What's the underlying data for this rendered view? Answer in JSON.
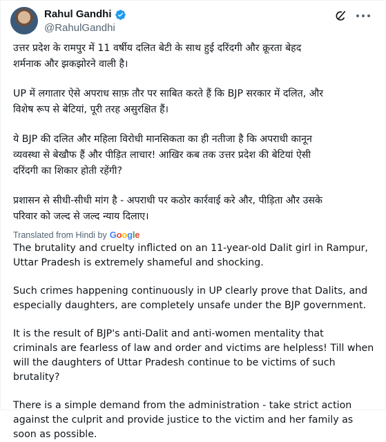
{
  "author": {
    "name": "Rahul Gandhi",
    "handle": "@RahulGandhi",
    "verified": true,
    "verified_color": "#1d9bf0"
  },
  "actions": {
    "grok_icon": "grok-icon",
    "more_icon": "more-icon"
  },
  "post": {
    "hindi_paragraphs": [
      "उत्तर प्रदेश के रामपुर में 11 वर्षीय दलित बेटी के साथ हुई दरिंदगी और क्रूरता बेहद\nशर्मनाक और झकझोरने वाली है।",
      "UP में लगातार ऐसे अपराध साफ़ तौर पर साबित करते हैं कि BJP सरकार में दलित, और\nविशेष रूप से बेटियां, पूरी तरह असुरक्षित हैं।",
      "ये BJP की दलित और महिला विरोधी मानसिकता का ही नतीजा है कि अपराधी कानून\nव्यवस्था से बेखौफ हैं और पीड़ित लाचार! आखिर कब तक उत्तर प्रदेश की बेटियां ऐसी\nदरिंदगी का शिकार होती रहेंगी?",
      "प्रशासन से सीधी-सीधी मांग है - अपराधी पर कठोर कार्रवाई करे और, पीड़िता और उसके\nपरिवार को जल्द से जल्द न्याय दिलाए।"
    ],
    "translated_label": "Translated from Hindi by",
    "translator_brand": "Google",
    "english_paragraphs": [
      "The brutality and cruelty inflicted on an 11-year-old Dalit girl in Rampur,\nUttar Pradesh is extremely shameful and shocking.",
      "Such crimes happening continuously in UP clearly prove that Dalits, and\nespecially daughters, are completely unsafe under the BJP government.",
      "It is the result of BJP's anti-Dalit and anti-women mentality that\ncriminals are fearless of law and order and victims are helpless! Till when\nwill the daughters of Uttar Pradesh continue to be victims of such\nbrutality?",
      "There is a simple demand from the administration - take strict action\nagainst the culprit and provide justice to the victim and her family as\nsoon as possible."
    ]
  }
}
